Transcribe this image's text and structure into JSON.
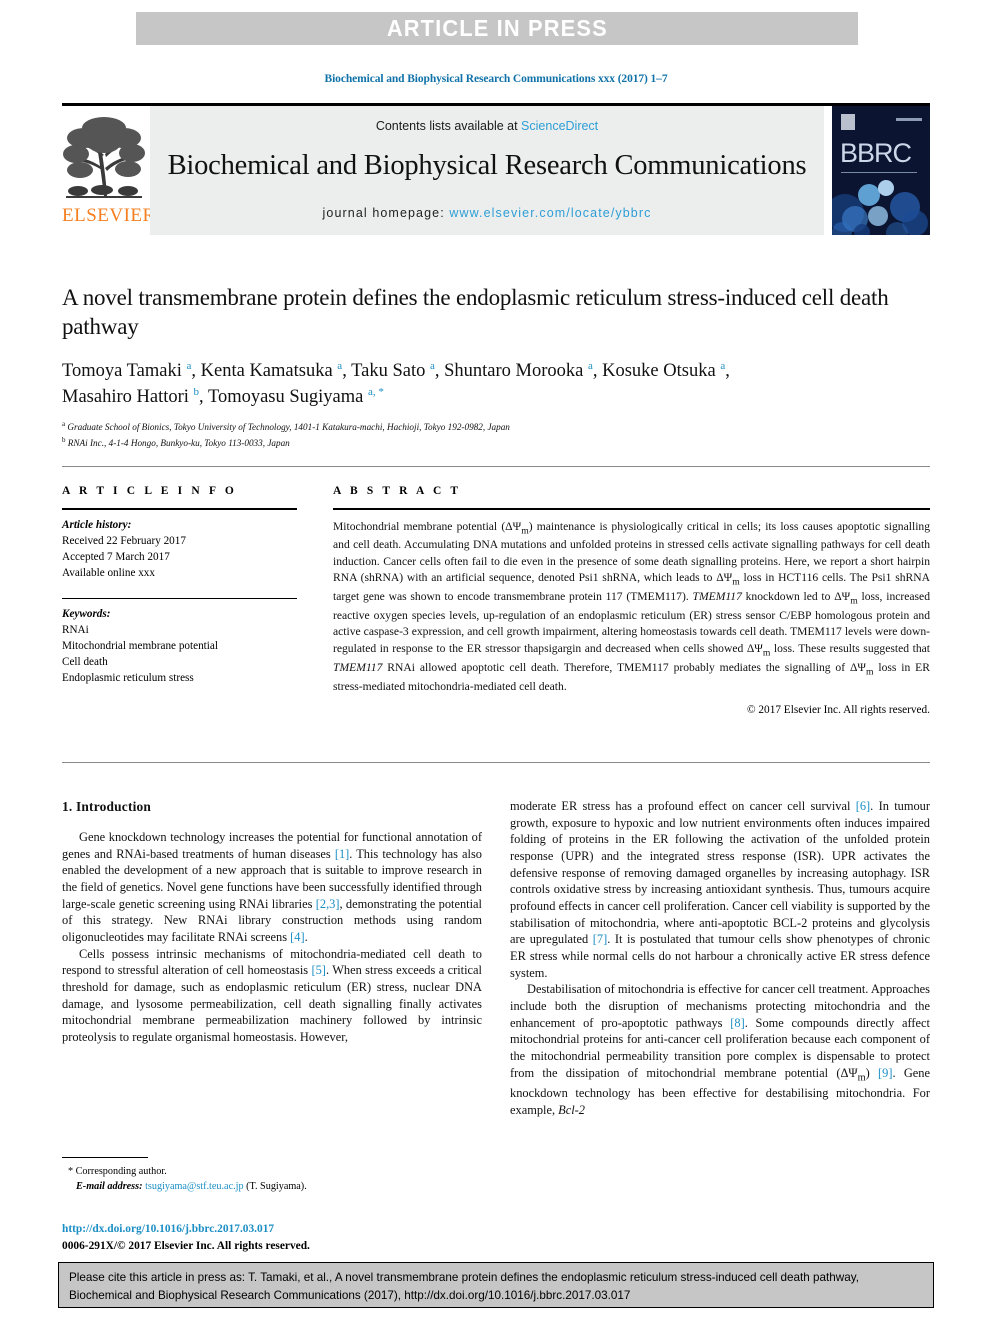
{
  "banner": {
    "text": "ARTICLE IN PRESS"
  },
  "journal_ref": "Biochemical and Biophysical Research Communications xxx (2017) 1–7",
  "masthead": {
    "contents_prefix": "Contents lists available at ",
    "sciencedirect": "ScienceDirect",
    "journal_title": "Biochemical and Biophysical Research Communications",
    "homepage_label": "journal homepage: ",
    "homepage_url": "www.elsevier.com/locate/ybbrc",
    "publisher": "ELSEVIER",
    "cover_word": "BBRC",
    "accent_blue": "#2e9fd6",
    "publisher_orange": "#f57f20",
    "banner_grey": "#c6c6c6"
  },
  "article": {
    "title": "A novel transmembrane protein defines the endoplasmic reticulum stress-induced cell death pathway",
    "authors_line1": "Tomoya Tamaki <sup>a</sup>, Kenta Kamatsuka <sup>a</sup>, Taku Sato <sup>a</sup>, Shuntaro Morooka <sup>a</sup>, Kosuke Otsuka <sup>a</sup>,",
    "authors_line2": "Masahiro Hattori <sup>b</sup>, Tomoyasu Sugiyama <sup>a, *</sup>",
    "affiliation_a": "<sup>a</sup> Graduate School of Bionics, Tokyo University of Technology, 1401-1 Katakura-machi, Hachioji, Tokyo 192-0982, Japan",
    "affiliation_b": "<sup>b</sup> RNAi Inc., 4-1-4 Hongo, Bunkyo-ku, Tokyo 113-0033, Japan"
  },
  "article_info": {
    "heading": "A R T I C L E  I N F O",
    "history_label": "Article history:",
    "received": "Received 22 February 2017",
    "accepted": "Accepted 7 March 2017",
    "available": "Available online xxx",
    "keywords_label": "Keywords:",
    "keywords": [
      "RNAi",
      "Mitochondrial membrane potential",
      "Cell death",
      "Endoplasmic reticulum stress"
    ]
  },
  "abstract": {
    "heading": "A B S T R A C T",
    "text": "Mitochondrial membrane potential (ΔΨ<sub>m</sub>) maintenance is physiologically critical in cells; its loss causes apoptotic signalling and cell death. Accumulating DNA mutations and unfolded proteins in stressed cells activate signalling pathways for cell death induction. Cancer cells often fail to die even in the presence of some death signalling proteins. Here, we report a short hairpin RNA (shRNA) with an artificial sequence, denoted Psi1 shRNA, which leads to ΔΨ<sub>m</sub> loss in HCT116 cells. The Psi1 shRNA target gene was shown to encode transmembrane protein 117 (TMEM117). <i>TMEM117</i> knockdown led to ΔΨ<sub>m</sub> loss, increased reactive oxygen species levels, up-regulation of an endoplasmic reticulum (ER) stress sensor C/EBP homologous protein and active caspase-3 expression, and cell growth impairment, altering homeostasis towards cell death. TMEM117 levels were down-regulated in response to the ER stressor thapsigargin and decreased when cells showed ΔΨ<sub>m</sub> loss. These results suggested that <i>TMEM117</i> RNAi allowed apoptotic cell death. Therefore, TMEM117 probably mediates the signalling of ΔΨ<sub>m</sub> loss in ER stress-mediated mitochondria-mediated cell death.",
    "copyright": "© 2017 Elsevier Inc. All rights reserved."
  },
  "body": {
    "section_heading": "1. Introduction",
    "left_paragraphs": [
      "Gene knockdown technology increases the potential for functional annotation of genes and RNAi-based treatments of human diseases <span class=\"ref\">[1]</span>. This technology has also enabled the development of a new approach that is suitable to improve research in the field of genetics. Novel gene functions have been successfully identified through large-scale genetic screening using RNAi libraries <span class=\"ref\">[2,3]</span>, demonstrating the potential of this strategy. New RNAi library construction methods using random oligonucleotides may facilitate RNAi screens <span class=\"ref\">[4]</span>.",
      "Cells possess intrinsic mechanisms of mitochondria-mediated cell death to respond to stressful alteration of cell homeostasis <span class=\"ref\">[5]</span>. When stress exceeds a critical threshold for damage, such as endoplasmic reticulum (ER) stress, nuclear DNA damage, and lysosome permeabilization, cell death signalling finally activates mitochondrial membrane permeabilization machinery followed by intrinsic proteolysis to regulate organismal homeostasis. However,"
    ],
    "right_paragraphs": [
      "moderate ER stress has a profound effect on cancer cell survival <span class=\"ref\">[6]</span>. In tumour growth, exposure to hypoxic and low nutrient environments often induces impaired folding of proteins in the ER following the activation of the unfolded protein response (UPR) and the integrated stress response (ISR). UPR activates the defensive response of removing damaged organelles by increasing autophagy. ISR controls oxidative stress by increasing antioxidant synthesis. Thus, tumours acquire profound effects in cancer cell proliferation. Cancer cell viability is supported by the stabilisation of mitochondria, where anti-apoptotic BCL-2 proteins and glycolysis are upregulated <span class=\"ref\">[7]</span>. It is postulated that tumour cells show phenotypes of chronic ER stress while normal cells do not harbour a chronically active ER stress defence system.",
      "Destabilisation of mitochondria is effective for cancer cell treatment. Approaches include both the disruption of mechanisms protecting mitochondria and the enhancement of pro-apoptotic pathways <span class=\"ref\">[8]</span>. Some compounds directly affect mitochondrial proteins for anti-cancer cell proliferation because each component of the mitochondrial permeability transition pore complex is dispensable to protect from the dissipation of mitochondrial membrane potential (ΔΨ<sub>m</sub>) <span class=\"ref\">[9]</span>. Gene knockdown technology has been effective for destabilising mitochondria. For example, <i>Bcl-2</i>"
    ]
  },
  "footnote": {
    "corresponding": "* Corresponding author.",
    "email_label": "E-mail address:",
    "email": "tsugiyama@stf.teu.ac.jp",
    "email_suffix": "(T. Sugiyama)."
  },
  "doi_block": {
    "doi_url": "http://dx.doi.org/10.1016/j.bbrc.2017.03.017",
    "issn_line": "0006-291X/© 2017 Elsevier Inc. All rights reserved."
  },
  "cite_box": {
    "text": "Please cite this article in press as: T. Tamaki, et al., A novel transmembrane protein defines the endoplasmic reticulum stress-induced cell death pathway, Biochemical and Biophysical Research Communications (2017), http://dx.doi.org/10.1016/j.bbrc.2017.03.017"
  }
}
